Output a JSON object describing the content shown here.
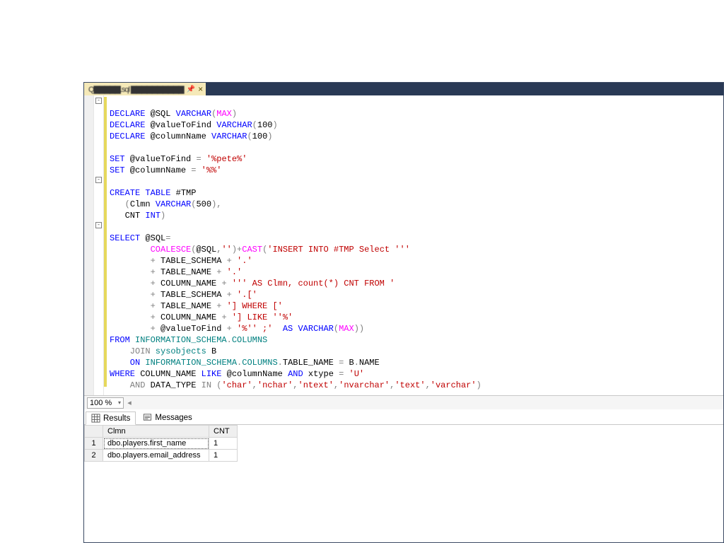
{
  "tab": {
    "pin_glyph": "📌",
    "close_glyph": "×"
  },
  "code": {
    "l1": {
      "a": "DECLARE",
      "b": " @SQL ",
      "c": "VARCHAR",
      "d": "(",
      "e": "MAX",
      "f": ")"
    },
    "l2": {
      "a": "DECLARE",
      "b": " @valueToFind ",
      "c": "VARCHAR",
      "d": "(",
      "e": "100",
      "f": ")"
    },
    "l3": {
      "a": "DECLARE",
      "b": " @columnName ",
      "c": "VARCHAR",
      "d": "(",
      "e": "100",
      "f": ")"
    },
    "l5": {
      "a": "SET",
      "b": " @valueToFind ",
      "c": "=",
      "d": " '%pete%'"
    },
    "l6": {
      "a": "SET",
      "b": " @columnName ",
      "c": "=",
      "d": " '%%'"
    },
    "l8": {
      "a": "CREATE",
      "b": " TABLE",
      "c": " #TMP"
    },
    "l9": {
      "a": "   (",
      "b": "Clmn ",
      "c": "VARCHAR",
      "d": "(",
      "e": "500",
      "f": "),"
    },
    "l10": {
      "a": "   CNT ",
      "b": "INT",
      "c": ")"
    },
    "l12": {
      "a": "SELECT",
      "b": " @SQL",
      "c": "="
    },
    "l13": {
      "a": "        COALESCE",
      "b": "(",
      "c": "@SQL",
      "d": ",",
      "e": "''",
      "f": ")+",
      "g": "CAST",
      "h": "(",
      "i": "'INSERT INTO #TMP Select '''"
    },
    "l14": {
      "a": "        + ",
      "b": "TABLE_SCHEMA ",
      "c": "+",
      "d": " '.'"
    },
    "l15": {
      "a": "        + ",
      "b": "TABLE_NAME ",
      "c": "+",
      "d": " '.'"
    },
    "l16": {
      "a": "        + ",
      "b": "COLUMN_NAME ",
      "c": "+",
      "d": " ''' AS Clmn, count(*) CNT FROM '"
    },
    "l17": {
      "a": "        + ",
      "b": "TABLE_SCHEMA ",
      "c": "+",
      "d": " '.['"
    },
    "l18": {
      "a": "        + ",
      "b": "TABLE_NAME ",
      "c": "+",
      "d": " '] WHERE ['"
    },
    "l19": {
      "a": "        + ",
      "b": "COLUMN_NAME ",
      "c": "+",
      "d": " '] LIKE ''%'"
    },
    "l20": {
      "a": "        + ",
      "b": "@valueToFind ",
      "c": "+",
      "d": " '%'' ;'",
      "e": "  AS",
      "f": " VARCHAR",
      "g": "(",
      "h": "MAX",
      "i": "))"
    },
    "l21": {
      "a": "FROM",
      "b": " INFORMATION_SCHEMA",
      "c": ".",
      "d": "COLUMNS"
    },
    "l22": {
      "a": "    JOIN",
      "b": " sysobjects",
      "c": " B"
    },
    "l23": {
      "a": "    ON",
      "b": " INFORMATION_SCHEMA",
      "c": ".",
      "d": "COLUMNS",
      "e": ".",
      "f": "TABLE_NAME ",
      "g": "=",
      "h": " B",
      "i": ".",
      "j": "NAME"
    },
    "l24": {
      "a": "WHERE",
      "b": " COLUMN_NAME ",
      "c": "LIKE",
      "d": " @columnName ",
      "e": "AND",
      "f": " xtype ",
      "g": "=",
      "h": " 'U'"
    },
    "l25": {
      "a": "    AND",
      "b": " DATA_TYPE ",
      "c": "IN",
      "d": " (",
      "e": "'char'",
      "f": ",",
      "g": "'nchar'",
      "h": ",",
      "i": "'ntext'",
      "j": ",",
      "k": "'nvarchar'",
      "l": ",",
      "m": "'text'",
      "n": ",",
      "o": "'varchar'",
      "p": ")"
    }
  },
  "zoom": {
    "value": "100 %",
    "chev": "▾"
  },
  "result_tabs": {
    "results": "Results",
    "messages": "Messages"
  },
  "grid": {
    "headers": {
      "c0": "",
      "c1": "Clmn",
      "c2": "CNT"
    },
    "rows": [
      {
        "n": "1",
        "clmn": "dbo.players.first_name",
        "cnt": "1"
      },
      {
        "n": "2",
        "clmn": "dbo.players.email_address",
        "cnt": "1"
      }
    ]
  }
}
